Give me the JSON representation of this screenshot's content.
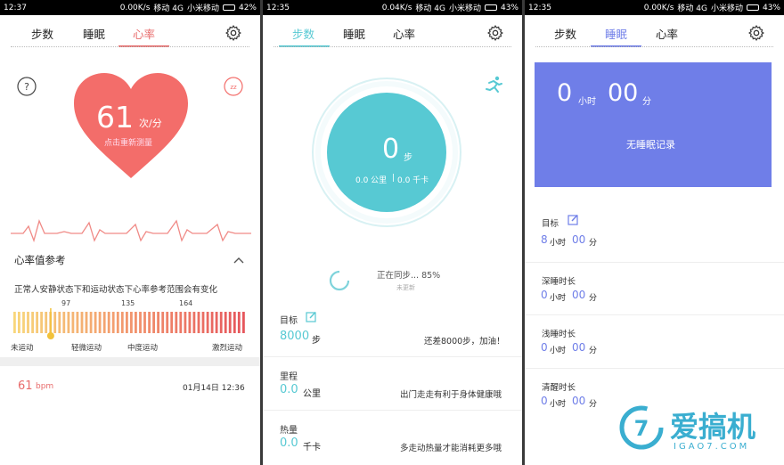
{
  "p1": {
    "status": {
      "time": "12:37",
      "speed": "0.00K/s",
      "carrier": "移动 4G",
      "carrier2": "小米移动",
      "battery": "42%"
    },
    "tabs": [
      "步数",
      "睡眠",
      "心率"
    ],
    "heart": {
      "value": "61",
      "unit": "次/分",
      "hint": "点击重新测量"
    },
    "ref": {
      "title": "心率值参考",
      "desc": "正常人安静状态下和运动状态下心率参考范围会有变化",
      "ticks": [
        "97",
        "135",
        "164"
      ],
      "zones": [
        "未运动",
        "轻微运动",
        "中度运动",
        "激烈运动"
      ],
      "marker_fraction": 0.16
    },
    "record": {
      "value": "61",
      "unit": "bpm",
      "time": "01月14日 12:36"
    }
  },
  "p2": {
    "status": {
      "time": "12:35",
      "speed": "0.04K/s",
      "carrier": "移动 4G",
      "carrier2": "小米移动",
      "battery": "43%"
    },
    "tabs": [
      "步数",
      "睡眠",
      "心率"
    ],
    "circle": {
      "steps": "0",
      "steps_unit": "步",
      "distance": "0.0 公里",
      "calories": "0.0 千卡"
    },
    "sync": {
      "text": "正在同步... 85%",
      "sub": "未更新"
    },
    "rows": [
      {
        "label": "目标",
        "value": "8000",
        "unit": "步",
        "note": "还差8000步，加油！"
      },
      {
        "label": "里程",
        "value": "0.0",
        "unit": "公里",
        "note": "出门走走有利于身体健康哦"
      },
      {
        "label": "热量",
        "value": "0.0",
        "unit": "千卡",
        "note": "多走动热量才能消耗更多哦"
      }
    ]
  },
  "p3": {
    "status": {
      "time": "12:35",
      "speed": "0.00K/s",
      "carrier": "移动 4G",
      "carrier2": "小米移动",
      "battery": "43%"
    },
    "tabs": [
      "步数",
      "睡眠",
      "心率"
    ],
    "card": {
      "hours": "0",
      "hours_unit": "小时",
      "minutes": "00",
      "minutes_unit": "分",
      "empty": "无睡眠记录"
    },
    "rows": [
      {
        "label": "目标",
        "h": "8",
        "hu": "小时",
        "m": "00",
        "mu": "分"
      },
      {
        "label": "深睡时长",
        "h": "0",
        "hu": "小时",
        "m": "00",
        "mu": "分"
      },
      {
        "label": "浅睡时长",
        "h": "0",
        "hu": "小时",
        "m": "00",
        "mu": "分"
      },
      {
        "label": "清醒时长",
        "h": "0",
        "hu": "小时",
        "m": "00",
        "mu": "分"
      }
    ],
    "watermark": {
      "brand": "爱搞机",
      "site": "IGAO7.COM"
    }
  },
  "colors": {
    "heart": "#f36d6a",
    "teal": "#57c9d3",
    "sleep": "#6f7ee8",
    "accent_red": "#e86c6c"
  }
}
